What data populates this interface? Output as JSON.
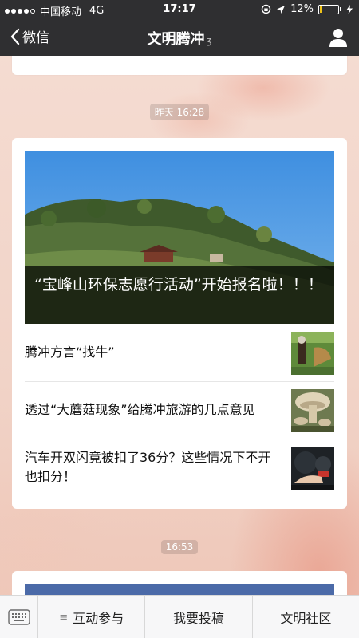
{
  "status_bar": {
    "carrier": "中国移动",
    "network": "4G",
    "time": "17:17",
    "battery": "12%",
    "battery_level": 0.12
  },
  "nav": {
    "back_label": "微信",
    "title": "文明腾冲"
  },
  "feed": {
    "timestamps": [
      "昨天 16:28",
      "16:53"
    ],
    "article_group": {
      "headline": "“宝峰山环保志愿行活动”开始报名啦！！！",
      "items": [
        {
          "title": "腾冲方言“找牛”",
          "thumb": "photo-field-thumb"
        },
        {
          "title": "透过“大蘑菇现象”给腾冲旅游的几点意见",
          "thumb": "photo-mushroom-thumb"
        },
        {
          "title": "汽车开双闪竟被扣了36分？这些情况下不开也扣分！",
          "thumb": "photo-car-thumb"
        }
      ]
    }
  },
  "bottom_menu": {
    "items": [
      "互动参与",
      "我要投稿",
      "文明社区"
    ]
  },
  "colors": {
    "bar": "#2f2f31",
    "background": "#f3d9cf",
    "caption_overlay": "#000000"
  }
}
